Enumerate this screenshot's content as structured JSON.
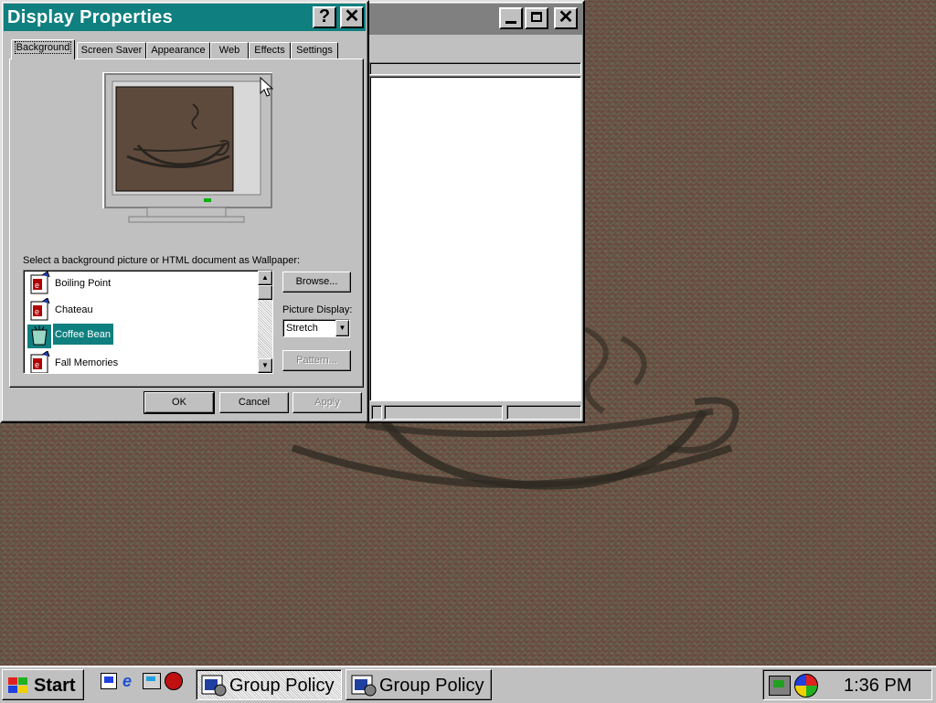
{
  "dialog": {
    "title": "Display Properties",
    "help_button": "?",
    "close_button": "✕",
    "tabs": [
      "Background",
      "Screen Saver",
      "Appearance",
      "Web",
      "Effects",
      "Settings"
    ],
    "active_tab": "Background",
    "wallpaper_prompt": "Select a background picture or HTML document as Wallpaper:",
    "wallpaper_list": [
      {
        "label": "Boiling Point",
        "icon": "html-document-icon",
        "selected": false
      },
      {
        "label": "Chateau",
        "icon": "html-document-icon",
        "selected": false
      },
      {
        "label": "Coffee Bean",
        "icon": "bitmap-image-icon",
        "selected": true
      },
      {
        "label": "Fall Memories",
        "icon": "html-document-icon",
        "selected": false
      }
    ],
    "browse_button": "Browse...",
    "picture_display_label": "Picture Display:",
    "picture_display_value": "Stretch",
    "pattern_button": "Pattern...",
    "ok_button": "OK",
    "cancel_button": "Cancel",
    "apply_button": "Apply"
  },
  "taskbar": {
    "start_label": "Start",
    "quick_launch": [
      "desktop-icon",
      "internet-explorer-icon",
      "channels-icon",
      "outlook-express-icon"
    ],
    "tasks": [
      "Group Policy",
      "Group Policy"
    ],
    "clock": "1:36 PM"
  },
  "colors": {
    "title_bar": "#0f7f7f",
    "selection": "#0f7f7f",
    "face": "#c0c0c0"
  }
}
